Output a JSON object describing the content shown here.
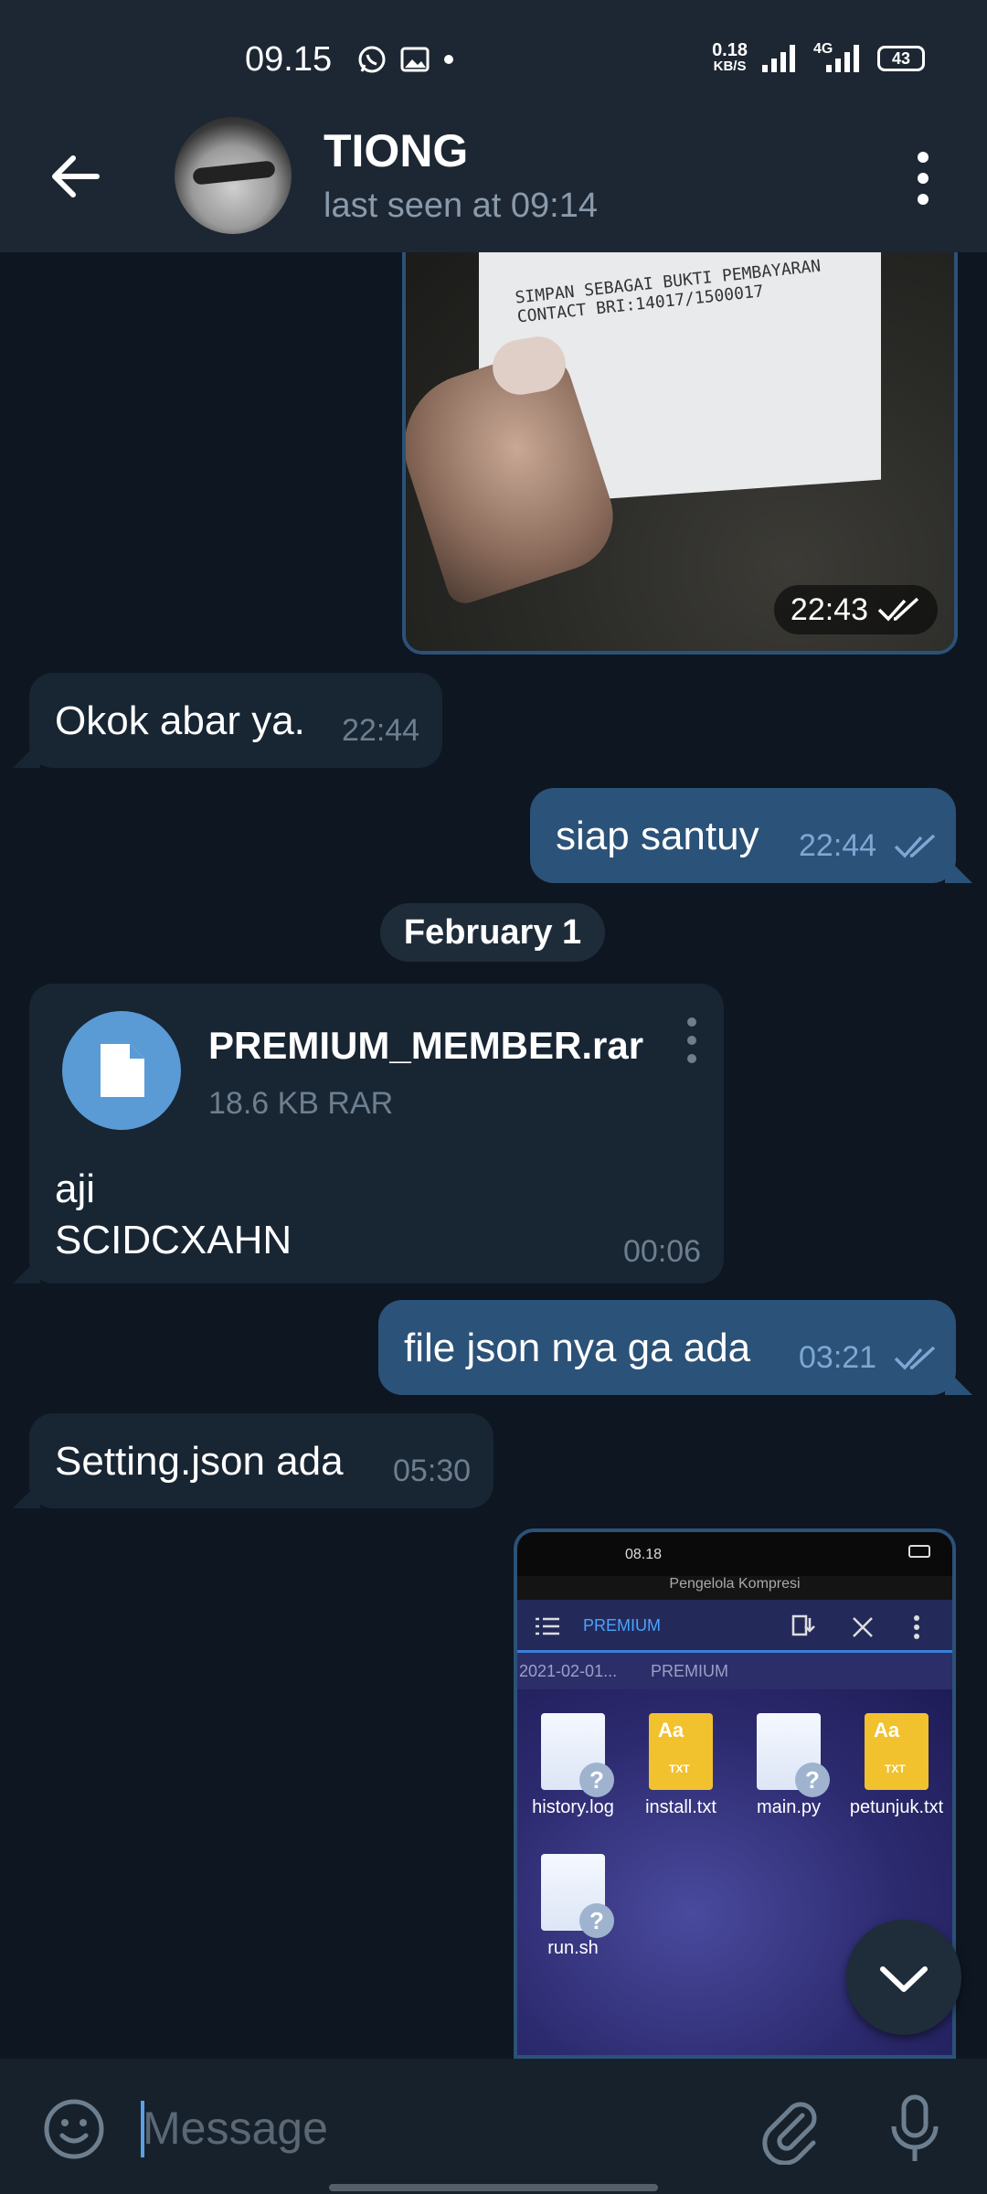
{
  "status_bar": {
    "time": "09.15",
    "speed_value": "0.18",
    "speed_unit": "KB/S",
    "network": "4G",
    "battery": "43"
  },
  "header": {
    "contact_name": "TIONG",
    "contact_status": "last seen at 09:14"
  },
  "messages": [
    {
      "type": "photo",
      "direction": "out",
      "time": "22:43",
      "photo_text": "SIMPAN SEBAGAI BUKTI PEMBAYARAN\nCONTACT BRI:14017/1500017"
    },
    {
      "type": "text",
      "direction": "in",
      "text": "Okok abar ya.",
      "time": "22:44"
    },
    {
      "type": "text",
      "direction": "out",
      "text": "siap santuy",
      "time": "22:44"
    },
    {
      "type": "date",
      "label": "February 1"
    },
    {
      "type": "file",
      "direction": "in",
      "file_name": "PREMIUM_MEMBER.rar",
      "file_meta": "18.6 KB RAR",
      "caption_line1": "aji",
      "caption_line2": "SCIDCXAHN",
      "time": "00:06"
    },
    {
      "type": "text",
      "direction": "out",
      "text": "file json nya ga ada",
      "time": "03:21"
    },
    {
      "type": "text",
      "direction": "in",
      "text": "Setting.json ada",
      "time": "05:30"
    },
    {
      "type": "screenshot",
      "direction": "out"
    }
  ],
  "screenshot_content": {
    "status_time": "08.18",
    "title_bar": "Pengelola Kompresi",
    "folder": "PREMIUM",
    "path_1": "2021-02-01...",
    "path_2": "PREMIUM",
    "files": [
      {
        "name": "history.log",
        "kind": "unknown"
      },
      {
        "name": "install.txt",
        "kind": "txt"
      },
      {
        "name": "main.py",
        "kind": "unknown"
      },
      {
        "name": "petunjuk.txt",
        "kind": "txt"
      },
      {
        "name": "run.sh",
        "kind": "unknown"
      }
    ]
  },
  "input": {
    "placeholder": "Message"
  },
  "colors": {
    "chat_bg": "#0e1621",
    "bar_bg": "#1d2733",
    "bubble_in": "#182533",
    "bubble_out": "#2b5278",
    "accent": "#5a9bd6"
  }
}
